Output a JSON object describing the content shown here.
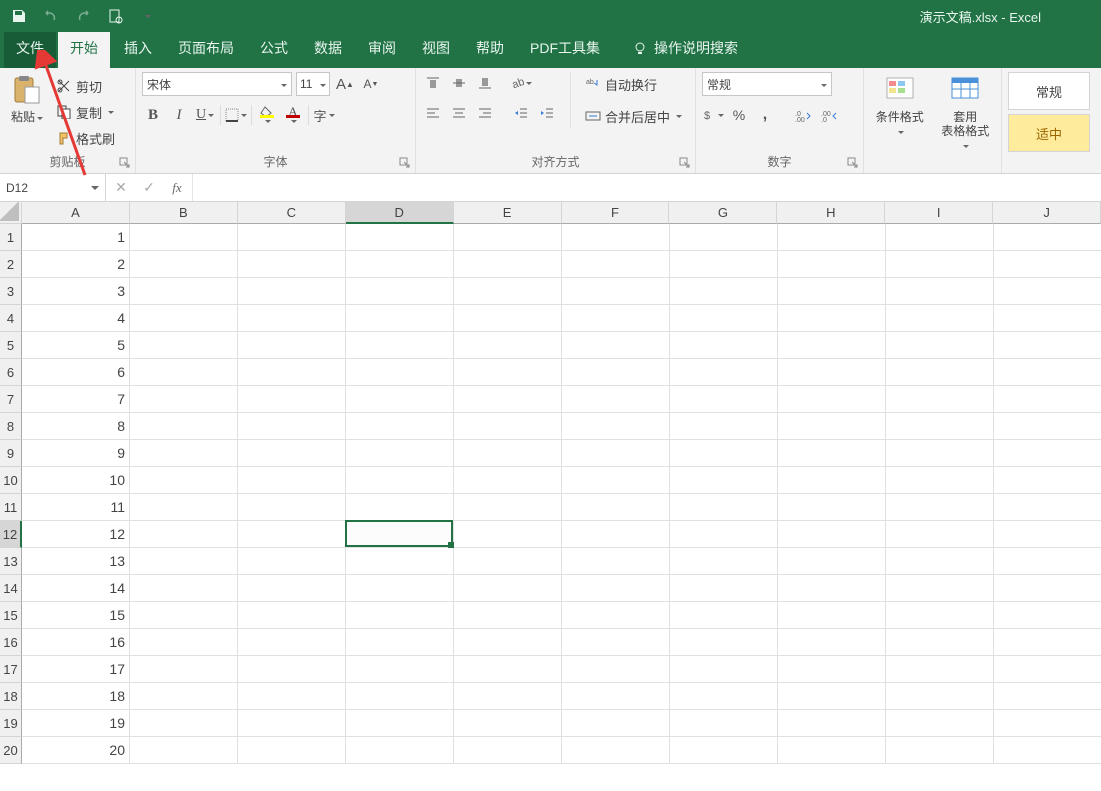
{
  "title": "演示文稿.xlsx  -  Excel",
  "tabs": {
    "file": "文件",
    "home": "开始",
    "insert": "插入",
    "layout": "页面布局",
    "formula": "公式",
    "data": "数据",
    "review": "审阅",
    "view": "视图",
    "help": "帮助",
    "pdf": "PDF工具集",
    "search": "操作说明搜索"
  },
  "clipboard": {
    "paste": "粘贴",
    "cut": "剪切",
    "copy": "复制",
    "format_painter": "格式刷",
    "group": "剪贴板"
  },
  "font": {
    "name": "宋体",
    "size": "11",
    "group": "字体"
  },
  "align": {
    "wrap": "自动换行",
    "merge": "合并后居中",
    "group": "对齐方式"
  },
  "number": {
    "format": "常规",
    "group": "数字"
  },
  "styles_group": {
    "cond": "条件格式",
    "table": "套用\n表格格式",
    "normal": "常规",
    "good": "适中"
  },
  "namebox": "D12",
  "columns": [
    "A",
    "B",
    "C",
    "D",
    "E",
    "F",
    "G",
    "H",
    "I",
    "J"
  ],
  "rows": [
    "1",
    "2",
    "3",
    "4",
    "5",
    "6",
    "7",
    "8",
    "9",
    "10",
    "11",
    "12",
    "13",
    "14",
    "15",
    "16",
    "17",
    "18",
    "19",
    "20"
  ],
  "cellA": [
    "1",
    "2",
    "3",
    "4",
    "5",
    "6",
    "7",
    "8",
    "9",
    "10",
    "11",
    "12",
    "13",
    "14",
    "15",
    "16",
    "17",
    "18",
    "19",
    "20"
  ],
  "selected_col_index": 3,
  "selected_row_index": 11
}
